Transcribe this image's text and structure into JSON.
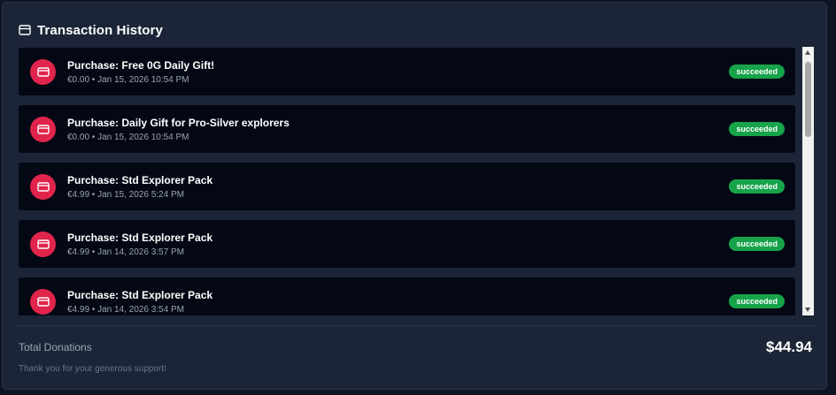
{
  "header": {
    "title": "Transaction History",
    "icon": "credit-card-icon"
  },
  "transactions": [
    {
      "name": "Purchase: Free 0G Daily Gift!",
      "amount": "€0.00",
      "date": "Jan 15, 2026 10:54 PM",
      "status": "succeeded",
      "icon": "credit-card-icon"
    },
    {
      "name": "Purchase: Daily Gift for Pro-Silver explorers",
      "amount": "€0.00",
      "date": "Jan 15, 2026 10:54 PM",
      "status": "succeeded",
      "icon": "credit-card-icon"
    },
    {
      "name": "Purchase: Std Explorer Pack",
      "amount": "€4.99",
      "date": "Jan 15, 2026 5:24 PM",
      "status": "succeeded",
      "icon": "credit-card-icon"
    },
    {
      "name": "Purchase: Std Explorer Pack",
      "amount": "€4.99",
      "date": "Jan 14, 2026 3:57 PM",
      "status": "succeeded",
      "icon": "credit-card-icon"
    },
    {
      "name": "Purchase: Std Explorer Pack",
      "amount": "€4.99",
      "date": "Jan 14, 2026 3:54 PM",
      "status": "succeeded",
      "icon": "credit-card-icon"
    }
  ],
  "footer": {
    "total_label": "Total Donations",
    "total_value": "$44.94",
    "thanks": "Thank you for your generous support!"
  },
  "colors": {
    "accent": "#e0244b",
    "success": "#16a34a",
    "panel": "#1b2537",
    "row": "#040815"
  }
}
